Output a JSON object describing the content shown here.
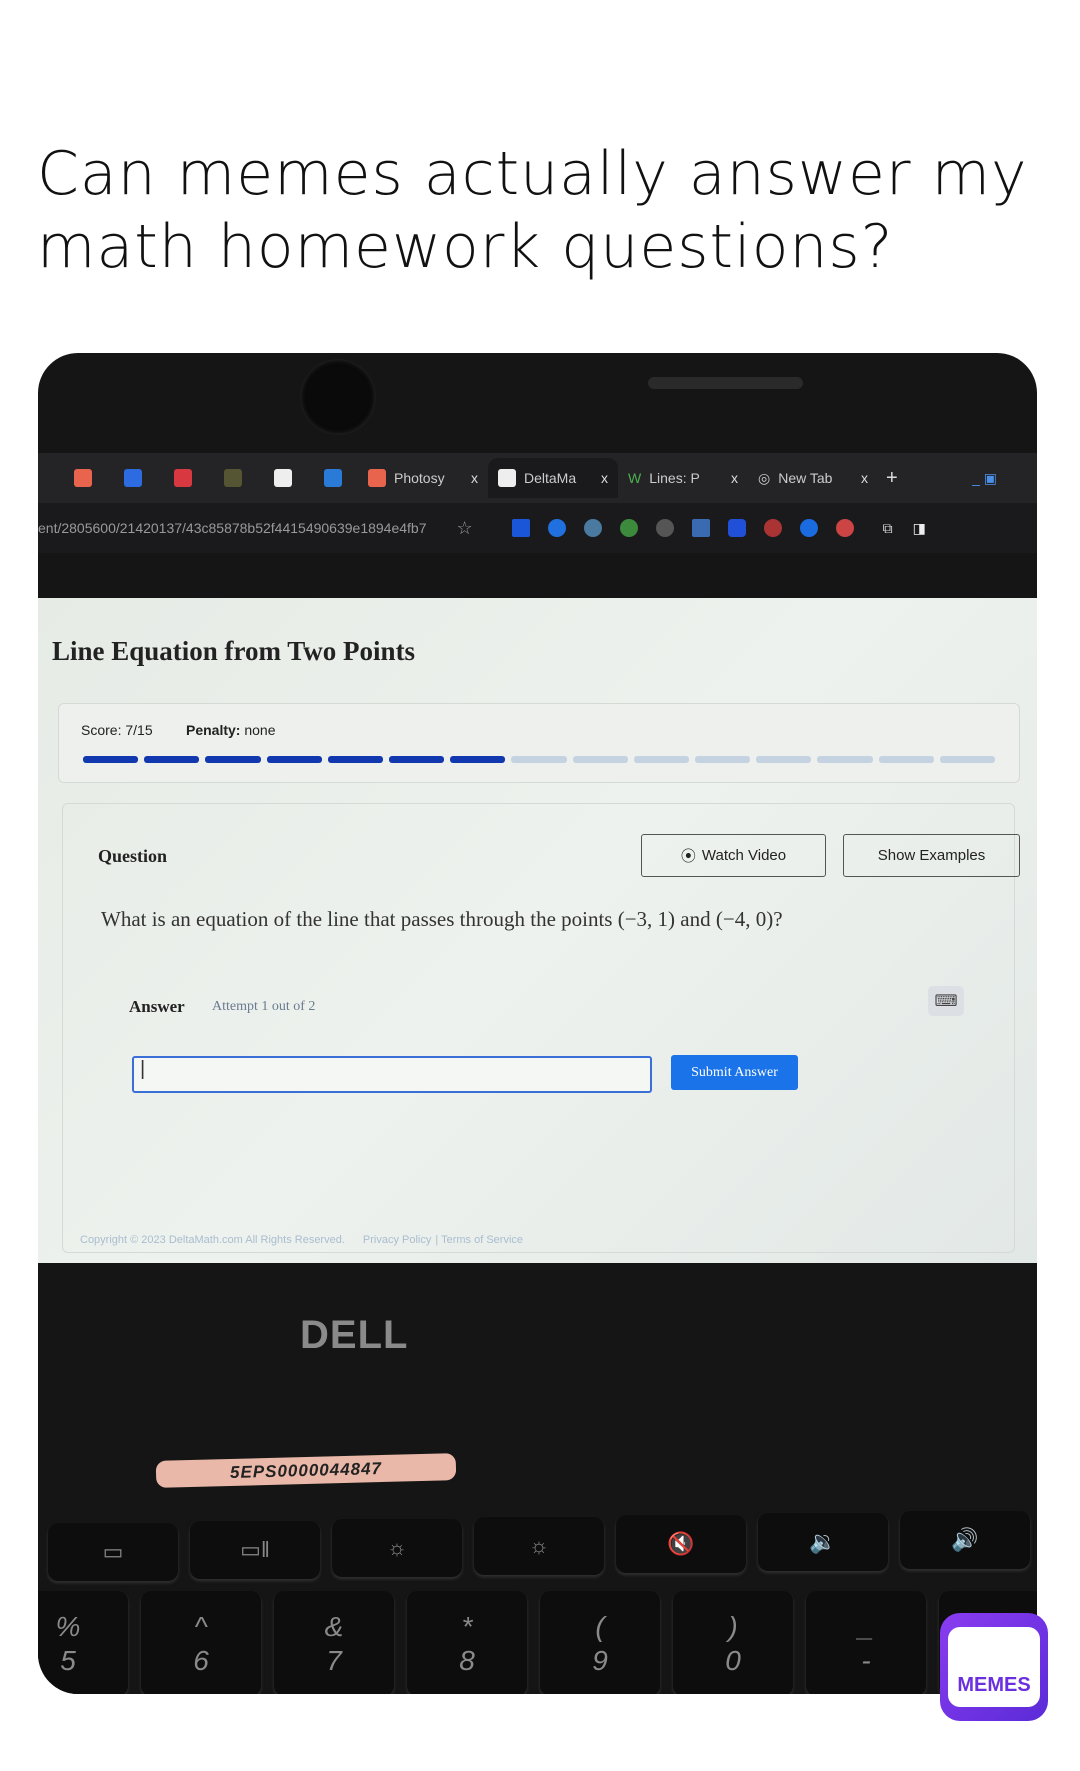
{
  "caption": "Can memes actually answer my math homework questions?",
  "browser": {
    "tabs": [
      {
        "label": "Photosy",
        "active": false
      },
      {
        "label": "DeltaMa",
        "active": true
      },
      {
        "label": "Lines: P",
        "active": false
      },
      {
        "label": "New Tab",
        "active": false
      }
    ],
    "close_label": "x",
    "new_tab_label": "+",
    "url": "ent/2805600/21420137/43c85878b52f4415490639e1894e4fb7"
  },
  "page": {
    "title": "Line Equation from Two Points",
    "score_label": "Score: 7/15",
    "penalty_label": "Penalty:",
    "penalty_value": "none",
    "progress": {
      "completed": 7,
      "total": 15,
      "filled_color": "#1238b0",
      "empty_color": "#c5d2e2"
    },
    "question_label": "Question",
    "watch_video": "Watch Video",
    "show_examples": "Show Examples",
    "question_text": "What is an equation of the line that passes through the points (−3, 1) and (−4, 0)?",
    "answer_label": "Answer",
    "attempt": "Attempt 1 out of 2",
    "answer_value": "|",
    "submit": "Submit Answer",
    "footer": {
      "copyright": "Copyright © 2023 DeltaMath.com All Rights Reserved.",
      "privacy": "Privacy Policy",
      "terms": "Terms of Service"
    }
  },
  "laptop": {
    "brand": "DELL",
    "asset_tag": "5EPS0000044847",
    "fn_keys": [
      "▭",
      "▭ǁ",
      "☼",
      "☼",
      "🔇",
      "🔉",
      "🔊"
    ],
    "num_keys": [
      {
        "top": "%",
        "bottom": "5"
      },
      {
        "top": "^",
        "bottom": "6"
      },
      {
        "top": "&",
        "bottom": "7"
      },
      {
        "top": "*",
        "bottom": "8"
      },
      {
        "top": "(",
        "bottom": "9"
      },
      {
        "top": ")",
        "bottom": "0"
      },
      {
        "top": "_",
        "bottom": "-"
      },
      {
        "top": "+",
        "bottom": ""
      }
    ]
  },
  "watermark": "MEMES"
}
